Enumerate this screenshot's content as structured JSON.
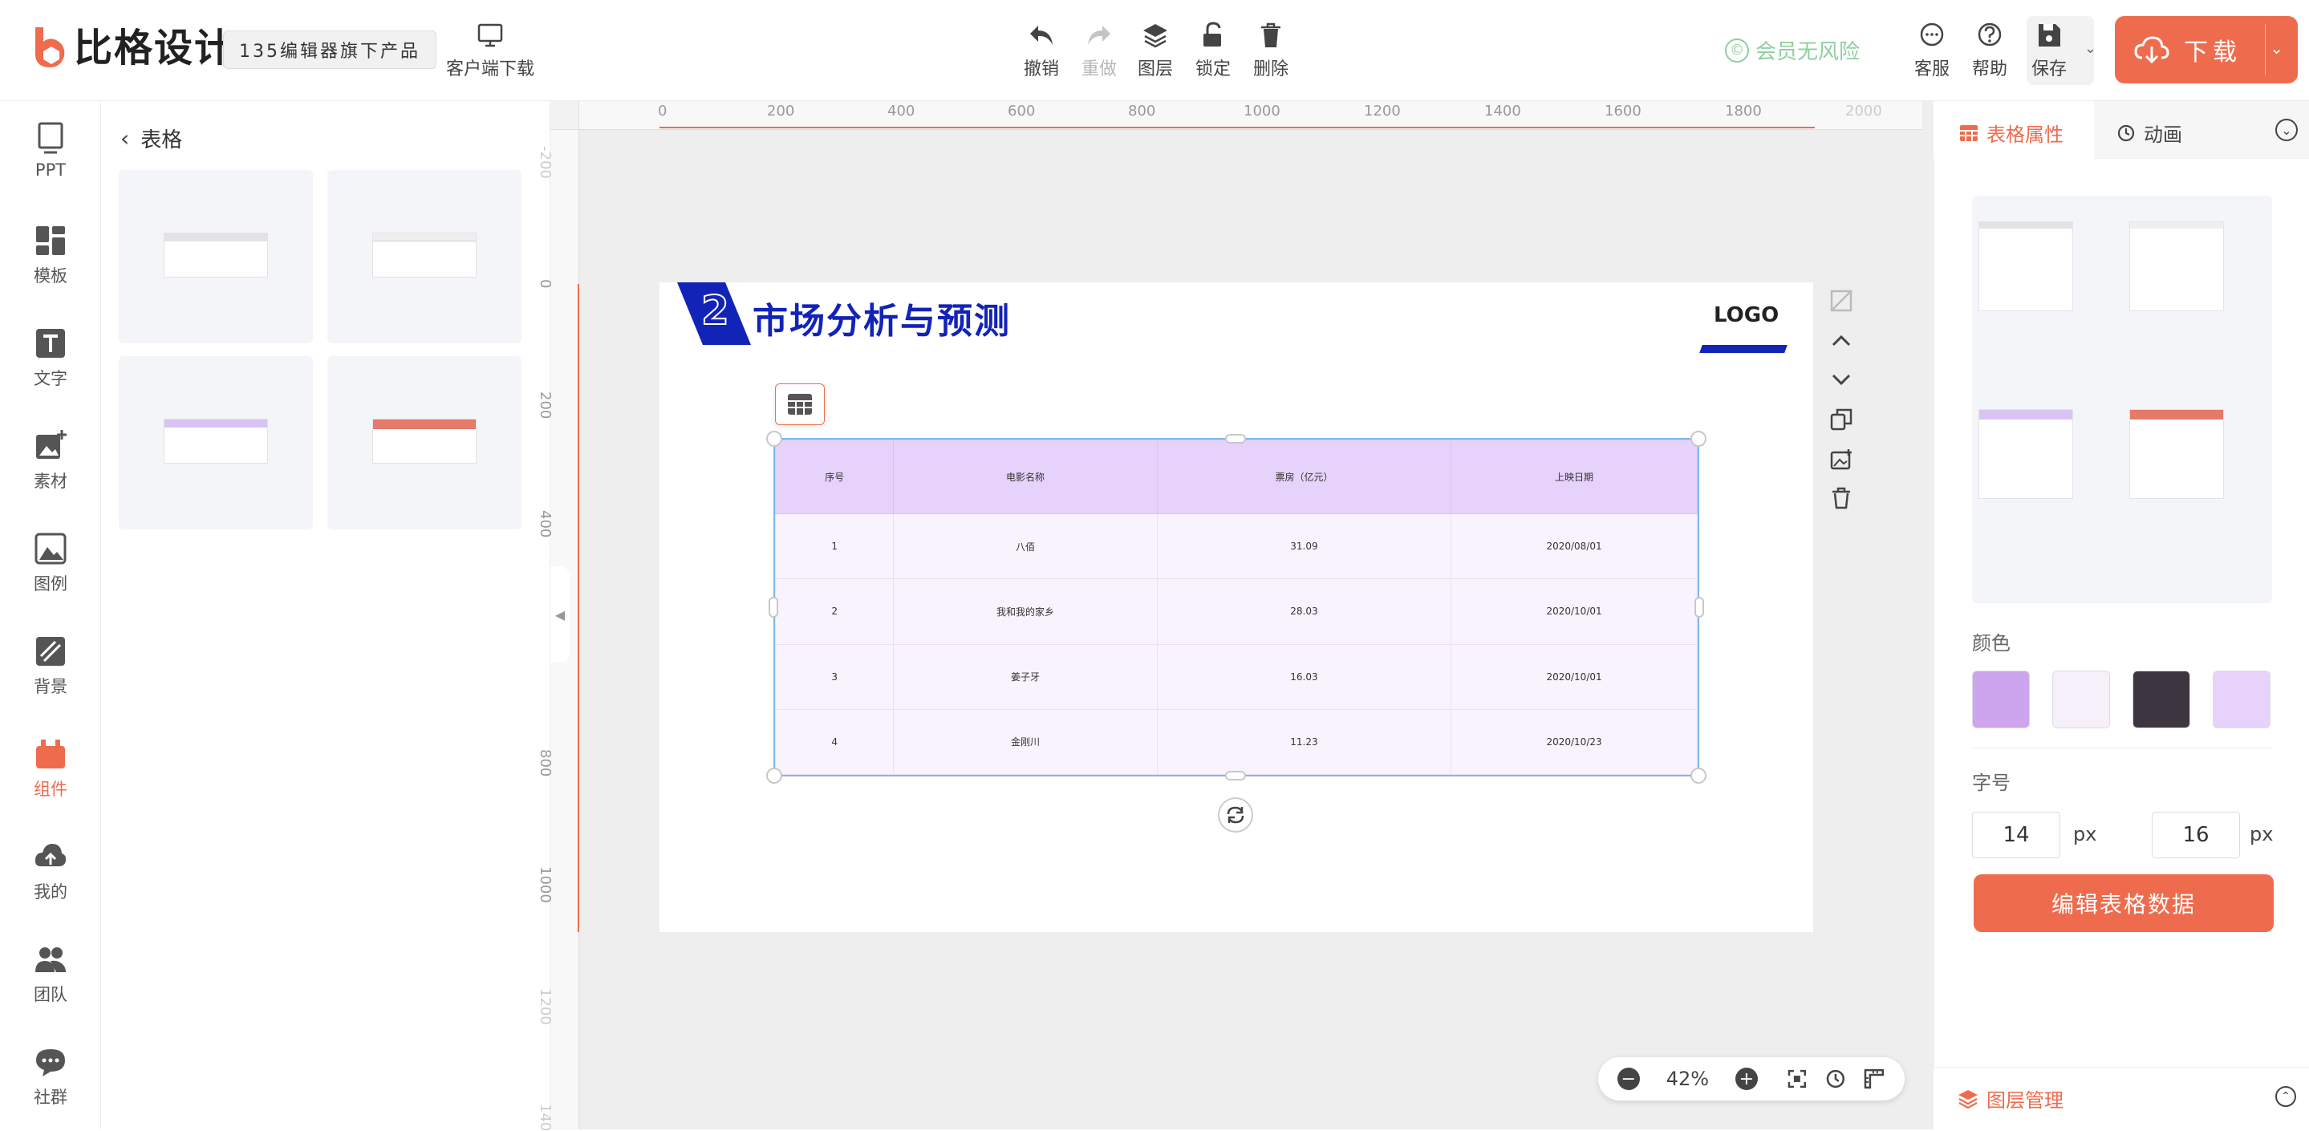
{
  "header": {
    "brand": "比格设计",
    "badge": "135编辑器旗下产品",
    "client_download": "客户端下载",
    "tools": [
      "撤销",
      "重做",
      "图层",
      "锁定",
      "删除"
    ],
    "member": "会员无风险",
    "member_icon": "©",
    "right_tools": [
      "客服",
      "帮助",
      "保存"
    ],
    "download": "下载"
  },
  "nav": {
    "items": [
      "PPT",
      "模板",
      "文字",
      "素材",
      "图例",
      "背景",
      "组件",
      "我的",
      "团队",
      "社群"
    ],
    "active": "组件"
  },
  "panel": {
    "back_title": "表格"
  },
  "ruler": {
    "top": [
      "0",
      "200",
      "400",
      "600",
      "800",
      "1000",
      "1200",
      "1400",
      "1600",
      "1800",
      "2000"
    ],
    "left": [
      "-200",
      "0",
      "200",
      "400",
      "800",
      "1000",
      "1200",
      "140"
    ]
  },
  "slide": {
    "number": "2",
    "title": "市场分析与预测",
    "logo": "LOGO",
    "table": {
      "headers": [
        "序号",
        "电影名称",
        "票房（亿元）",
        "上映日期"
      ],
      "rows": [
        [
          "1",
          "八佰",
          "31.09",
          "2020/08/01"
        ],
        [
          "2",
          "我和我的家乡",
          "28.03",
          "2020/10/01"
        ],
        [
          "3",
          "姜子牙",
          "16.03",
          "2020/10/01"
        ],
        [
          "4",
          "金刚川",
          "11.23",
          "2020/10/23"
        ]
      ]
    }
  },
  "zoom": {
    "value": "42%"
  },
  "right": {
    "tab_active": "表格属性",
    "tab_other": "动画",
    "color_label": "颜色",
    "colors": [
      "#cda4ee",
      "#f6f0fb",
      "#3d3640",
      "#e6d2fb"
    ],
    "font_label": "字号",
    "font_min": "14",
    "font_max": "16",
    "unit": "px",
    "edit_button": "编辑表格数据",
    "layers": "图层管理"
  }
}
